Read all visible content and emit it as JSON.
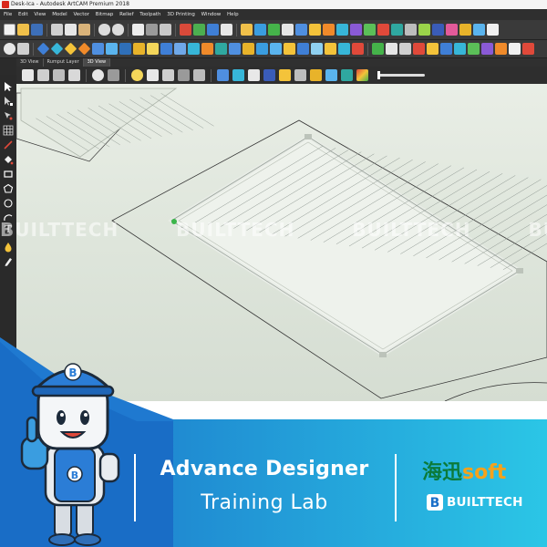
{
  "window": {
    "title": "Desk-Ica - Autodesk ArtCAM Premium 2018",
    "menu": [
      "File",
      "Edit",
      "View",
      "Model",
      "Vector",
      "Bitmap",
      "Relief",
      "Toolpath",
      "3D Printing",
      "Window",
      "Help"
    ]
  },
  "tabs": [
    {
      "label": "3D View",
      "active": false
    },
    {
      "label": "Rumput Layer",
      "active": false
    },
    {
      "label": "3D View",
      "active": true
    }
  ],
  "toolbar_icons": {
    "row1": [
      "new-file-icon",
      "open-folder-icon",
      "save-icon",
      "cut-icon",
      "copy-icon",
      "paste-icon",
      "undo-icon",
      "redo-icon",
      "layers-icon",
      "vector-icon"
    ],
    "row2": [
      "zoom-icon",
      "select-icon",
      "relief-icon",
      "toolpath-icon"
    ]
  },
  "left_tools": [
    "select-arrow-icon",
    "node-edit-icon",
    "transform-icon",
    "grid-icon",
    "line-icon",
    "fill-icon",
    "rectangle-icon",
    "polygon-icon",
    "arc-icon",
    "text-icon",
    "drop-icon"
  ],
  "left_tools_text": "T",
  "viewport": {
    "background_top": "#e9eee6",
    "background_bottom": "#d5ddd2",
    "model_outline": "#e8ece6",
    "toolpath_lines": "#8d9690"
  },
  "palette_colors": [
    "#ffffff",
    "#ce2a8a",
    "#f3d24a",
    "#9aa0a6",
    "#f3d24a",
    "#f3b22a"
  ],
  "watermark": [
    "BUILTTECH",
    "BUILTTECH",
    "BUILTTECH",
    "BUILTTECH"
  ],
  "banner": {
    "course_title": "Advance Designer",
    "course_subtitle": "Training Lab",
    "gradient_start": "#1a6fc8",
    "gradient_end": "#2bc6e6"
  },
  "brands": {
    "haixun_cn": "海迅",
    "haixun_en": "soft",
    "builttech": "BUILTTECH",
    "builttech_logo_letter": "B"
  },
  "mascot": {
    "cap_letter": "B",
    "chest_letter": "B"
  }
}
